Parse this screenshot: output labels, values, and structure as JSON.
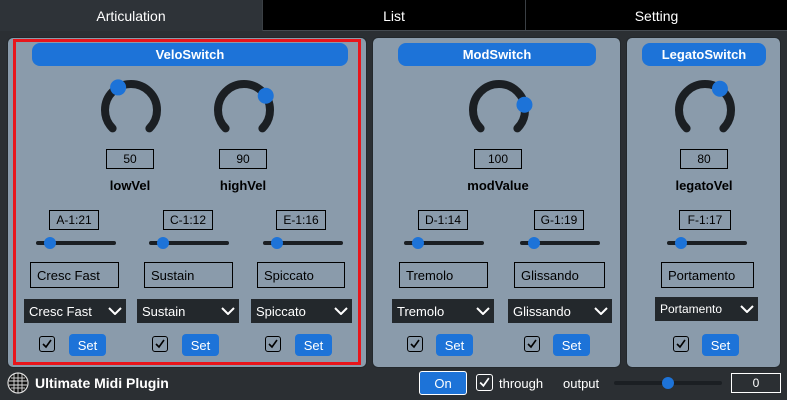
{
  "tabs": [
    {
      "label": "Articulation",
      "active": true
    },
    {
      "label": "List",
      "active": false
    },
    {
      "label": "Setting",
      "active": false
    }
  ],
  "colors": {
    "accent": "#1d73d8",
    "panel": "#8a9bab",
    "background": "#2b2f33",
    "selection_frame": "#e8151b"
  },
  "panels": {
    "velo": {
      "title": "VeloSwitch",
      "knobs": [
        {
          "label": "lowVel",
          "value": "50",
          "fraction": 0.39
        },
        {
          "label": "highVel",
          "value": "90",
          "fraction": 0.71
        }
      ],
      "slots": [
        {
          "key": "A-1:21",
          "slider": 0.12,
          "text": "Cresc Fast",
          "select": "Cresc Fast",
          "checked": true,
          "set_label": "Set"
        },
        {
          "key": "C-1:12",
          "slider": 0.12,
          "text": "Sustain",
          "select": "Sustain",
          "checked": true,
          "set_label": "Set"
        },
        {
          "key": "E-1:16",
          "slider": 0.12,
          "text": "Spiccato",
          "select": "Spiccato",
          "checked": true,
          "set_label": "Set"
        }
      ]
    },
    "mod": {
      "title": "ModSwitch",
      "knobs": [
        {
          "label": "modValue",
          "value": "100",
          "fraction": 0.79
        }
      ],
      "slots": [
        {
          "key": "D-1:14",
          "slider": 0.12,
          "text": "Tremolo",
          "select": "Tremolo",
          "checked": true,
          "set_label": "Set"
        },
        {
          "key": "G-1:19",
          "slider": 0.12,
          "text": "Glissando",
          "select": "Glissando",
          "checked": true,
          "set_label": "Set"
        }
      ]
    },
    "legato": {
      "title": "LegatoSwitch",
      "knobs": [
        {
          "label": "legatoVel",
          "value": "80",
          "fraction": 0.63
        }
      ],
      "slots": [
        {
          "key": "F-1:17",
          "slider": 0.12,
          "text": "Portamento",
          "select": "Portamento",
          "checked": true,
          "set_label": "Set"
        }
      ]
    }
  },
  "footer": {
    "app_name": "Ultimate Midi Plugin",
    "on_label": "On",
    "through_label": "through",
    "through_checked": true,
    "output_label": "output",
    "output_slider": 0.5,
    "output_value": "0"
  },
  "icons": {
    "logo": "globe-grid-icon",
    "chevron": "chevron-down-icon",
    "check": "checkmark-icon"
  }
}
